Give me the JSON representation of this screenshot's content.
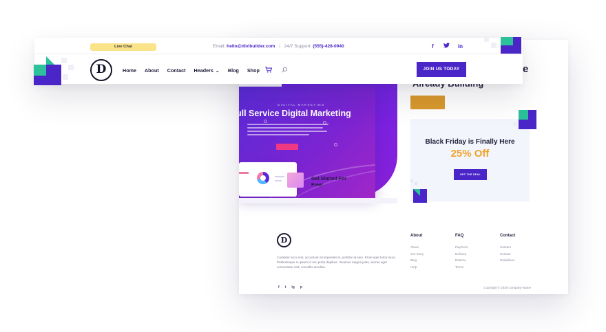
{
  "header": {
    "live_chat": "Live Chat",
    "email_label": "Email:",
    "email_value": "hello@divibuilder.com",
    "support_label": "24/7 Support:",
    "support_value": "(555)-428-0940",
    "logo_letter": "D",
    "nav": [
      {
        "label": "Home"
      },
      {
        "label": "About"
      },
      {
        "label": "Contact"
      },
      {
        "label": "Headers"
      },
      {
        "label": "Blog"
      },
      {
        "label": "Shop"
      }
    ],
    "join_label": "JOIN US TODAY",
    "socials": [
      "f",
      "t",
      "in"
    ]
  },
  "hero": {
    "eyebrow": "DIGITAL MARKETING",
    "title": "ull Service Digital Marketing",
    "get_started": "Get Started For Free!",
    "right_title_1": "e",
    "right_title_2": "Already Building"
  },
  "promo": {
    "title": "Black Friday is Finally Here",
    "offer": "25% Off",
    "button": "GET THE DEAL"
  },
  "footer": {
    "logo_letter": "D",
    "description": "Curabitur arcu erat, accumsan id imperdiet et, porttitor at sem. Proin eget tortor risus. Pellentesque in ipsum id orci porta dapibus. Vivamus magna justo, lacinia eget consectetur sed, convallis at tellus.",
    "columns": [
      {
        "title": "About",
        "items": [
          "About",
          "Our Story",
          "Blog",
          "Help"
        ]
      },
      {
        "title": "FAQ",
        "items": [
          "Payment",
          "Delivery",
          "Returns",
          "Terms"
        ]
      },
      {
        "title": "Contact",
        "items": [
          "Careers",
          "Contact",
          "Guidelines"
        ]
      }
    ],
    "socials": [
      "f",
      "t",
      "ig",
      "p"
    ],
    "copyright": "Copyright © 2020 Company Name"
  },
  "colors": {
    "brand_purple": "#4a26c9",
    "accent_green": "#2cc19a",
    "accent_gold": "#f0a32a",
    "live_chat_yellow": "#fbe38a"
  }
}
